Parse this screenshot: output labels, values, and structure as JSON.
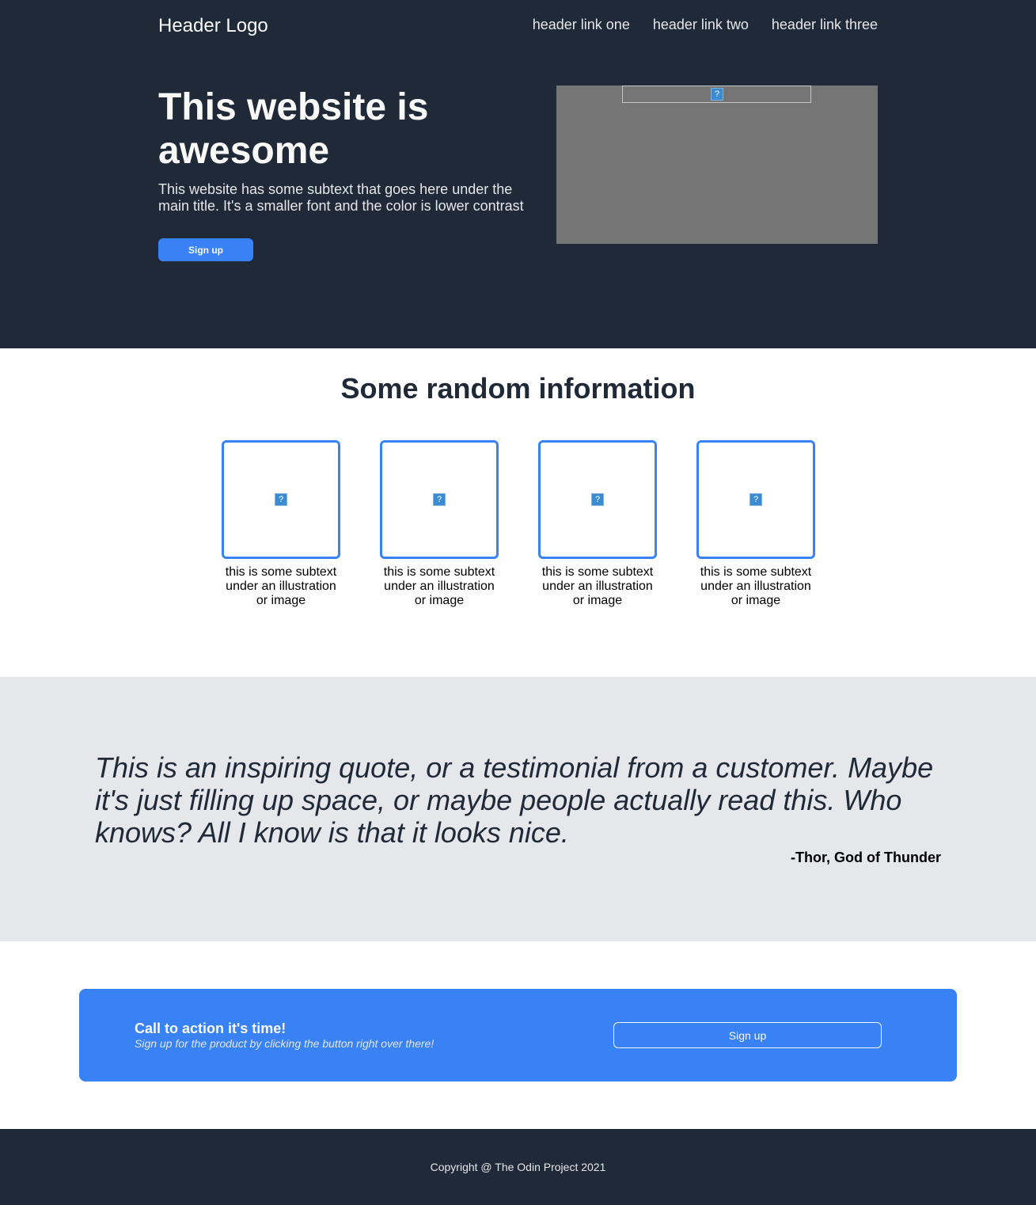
{
  "header": {
    "logo": "Header Logo",
    "links": [
      "header link one",
      "header link two",
      "header link three"
    ]
  },
  "hero": {
    "title": "This website is awesome",
    "subtitle": "This website has some subtext that goes here under the main title. It's a smaller font and the color is lower contrast",
    "button_label": "Sign up",
    "image_icon": "broken-image-icon",
    "broken_glyph": "?"
  },
  "info": {
    "title": "Some random information",
    "cards": [
      {
        "text": "this is some subtext under an illustration or image",
        "icon": "broken-image-icon"
      },
      {
        "text": "this is some subtext under an illustration or image",
        "icon": "broken-image-icon"
      },
      {
        "text": "this is some subtext under an illustration or image",
        "icon": "broken-image-icon"
      },
      {
        "text": "this is some subtext under an illustration or image",
        "icon": "broken-image-icon"
      }
    ]
  },
  "quote": {
    "text": "This is an inspiring quote, or a testimonial from a customer. Maybe it's just filling up space, or maybe people actually read this. Who knows? All I know is that it looks nice.",
    "author": "-Thor, God of Thunder"
  },
  "cta": {
    "title": "Call to action it's time!",
    "subtitle": "Sign up for the product by clicking the button right over there!",
    "button_label": "Sign up"
  },
  "footer": {
    "copyright": "Copyright @ The Odin Project 2021"
  },
  "colors": {
    "dark": "#1f2937",
    "accent": "#3882f6",
    "light_gray": "#e5e7eb",
    "image_gray": "#757575"
  }
}
